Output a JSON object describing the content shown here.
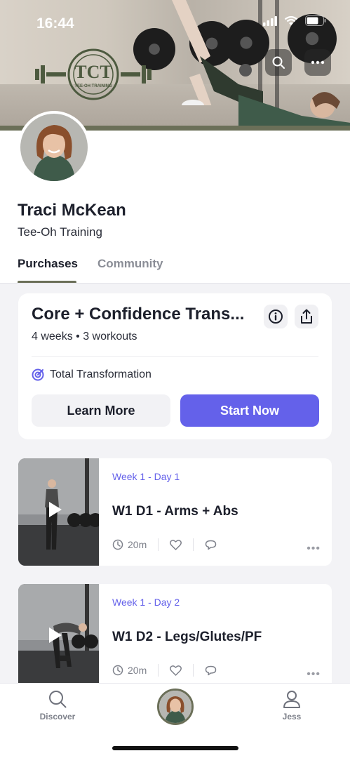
{
  "status_bar": {
    "time": "16:44",
    "icons": [
      "signal-icon",
      "wifi-icon",
      "battery-icon"
    ]
  },
  "header": {
    "logo_text": "TCT",
    "logo_subtext": "TEE-OH TRAINING",
    "actions": [
      "search-icon",
      "more-icon"
    ]
  },
  "profile": {
    "name": "Traci McKean",
    "brand": "Tee-Oh Training"
  },
  "tabs": [
    {
      "label": "Purchases",
      "active": true
    },
    {
      "label": "Community",
      "active": false
    }
  ],
  "program": {
    "title": "Core + Confidence Trans...",
    "meta": "4 weeks • 3 workouts",
    "goal": "Total Transformation",
    "learn_more": "Learn More",
    "start_now": "Start Now"
  },
  "workouts": [
    {
      "day": "Week 1 - Day 1",
      "title": "W1 D1 - Arms + Abs",
      "duration": "20m"
    },
    {
      "day": "Week 1 - Day 2",
      "title": "W1 D2 - Legs/Glutes/PF",
      "duration": "20m"
    }
  ],
  "bottom_nav": {
    "discover": "Discover",
    "profile": "Jess"
  },
  "colors": {
    "accent": "#6461ea",
    "brand_olive": "#6b6f58",
    "text": "#1c1f2b"
  }
}
